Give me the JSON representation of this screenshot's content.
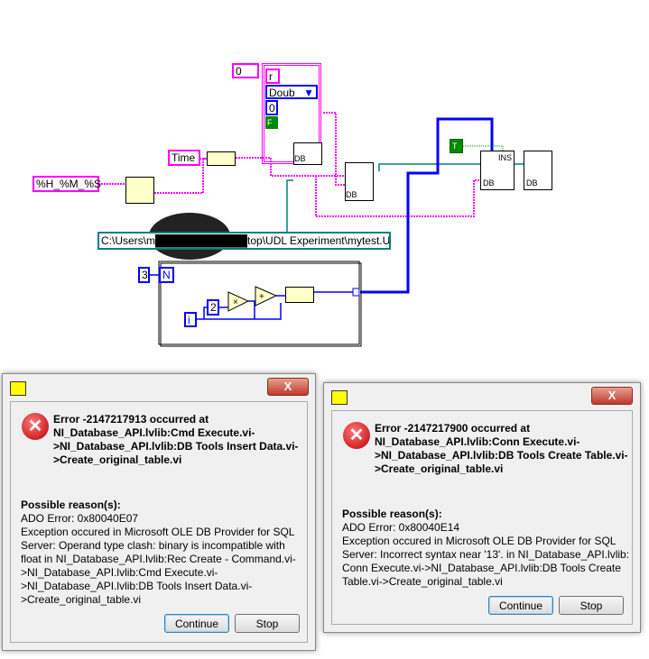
{
  "diagram": {
    "numeric_constant_0": "0",
    "cluster": {
      "field_r": "r",
      "enum_value": "Doub",
      "numeric": "0",
      "boolean": "F"
    },
    "time_constant": "Time",
    "format_string": "%H_%M_%S",
    "path_control": "C:\\Users\\m████████████top\\UDL Experiment\\mytest.UDL",
    "loop_count": "3",
    "loop_N": "N",
    "loop_i": "i",
    "multiplier": "2",
    "true_constant": "T",
    "db_label": "DB",
    "ins_label": "INS",
    "colors": {
      "string_wire": "#ff00ff",
      "numeric_wire": "#0000ff",
      "refnum_wire": "#008080",
      "boolean": "#008000"
    }
  },
  "dialog1": {
    "title_text": "Error -2147217913 occurred at\nNI_Database_API.lvlib:Cmd Execute.vi-\n>NI_Database_API.lvlib:DB Tools Insert Data.vi-\n>Create_original_table.vi",
    "reason_label": "Possible reason(s):",
    "reason_text": "ADO Error: 0x80040E07\nException occured in Microsoft OLE DB Provider for SQL\nServer: Operand type clash: binary is incompatible with\nfloat in NI_Database_API.lvlib:Rec Create - Command.vi-\n>NI_Database_API.lvlib:Cmd Execute.vi-\n>NI_Database_API.lvlib:DB Tools Insert Data.vi-\n>Create_original_table.vi",
    "continue_label": "Continue",
    "stop_label": "Stop",
    "close_label": "X"
  },
  "dialog2": {
    "title_text": "Error -2147217900 occurred at\nNI_Database_API.lvlib:Conn Execute.vi-\n>NI_Database_API.lvlib:DB Tools Create Table.vi-\n>Create_original_table.vi",
    "reason_label": "Possible reason(s):",
    "reason_text": "ADO Error: 0x80040E14\nException occured in Microsoft OLE DB Provider for SQL\nServer: Incorrect syntax near '13'. in NI_Database_API.lvlib:\nConn Execute.vi->NI_Database_API.lvlib:DB Tools Create\nTable.vi->Create_original_table.vi",
    "continue_label": "Continue",
    "stop_label": "Stop",
    "close_label": "X"
  }
}
